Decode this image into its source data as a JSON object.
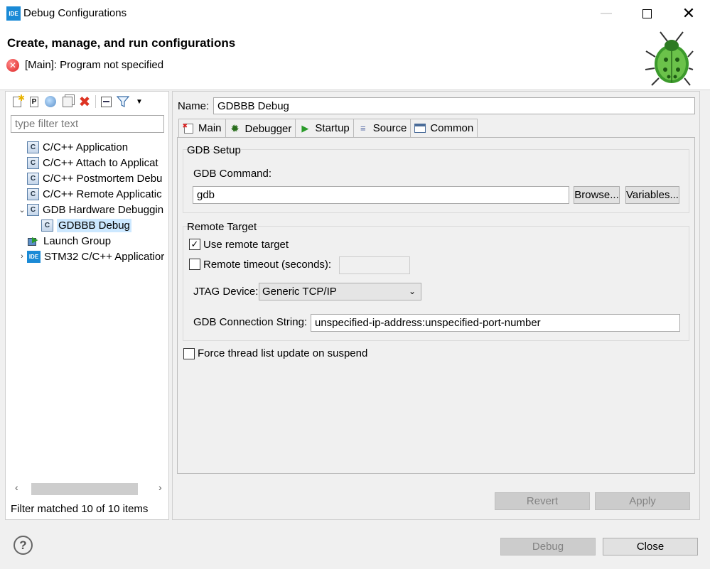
{
  "window": {
    "app_icon": "IDE",
    "title": "Debug Configurations",
    "minimize_icon": "minimize-icon",
    "maximize_icon": "maximize-icon",
    "close_icon": "close-icon"
  },
  "header": {
    "title": "Create, manage, and run configurations",
    "error_message": "[Main]: Program not specified"
  },
  "left_panel": {
    "toolbar_icons": [
      "new-configuration-icon",
      "new-prototype-icon",
      "export-icon",
      "duplicate-icon",
      "delete-icon",
      "collapse-all-icon",
      "filter-icon",
      "view-menu-icon"
    ],
    "filter_placeholder": "type filter text",
    "tree": [
      {
        "label": "C/C++ Application"
      },
      {
        "label": "C/C++ Attach to Applicat"
      },
      {
        "label": "C/C++ Postmortem Debu"
      },
      {
        "label": "C/C++ Remote Applicatic"
      },
      {
        "label": "GDB Hardware Debuggin"
      },
      {
        "label": "GDBBB Debug"
      },
      {
        "label": "Launch Group"
      },
      {
        "label": "STM32 C/C++ Applicatior"
      }
    ],
    "filter_status": "Filter matched 10 of 10 items"
  },
  "right_panel": {
    "name_label": "Name:",
    "name_value": "GDBBB Debug",
    "tabs": [
      {
        "label": "Main"
      },
      {
        "label": "Debugger"
      },
      {
        "label": "Startup"
      },
      {
        "label": "Source"
      },
      {
        "label": "Common"
      }
    ],
    "gdb_setup": {
      "title": "GDB Setup",
      "command_label": "GDB Command:",
      "command_value": "gdb",
      "browse_label": "Browse...",
      "variables_label": "Variables..."
    },
    "remote_target": {
      "title": "Remote Target",
      "use_remote_label": "Use remote target",
      "use_remote_checked": true,
      "timeout_label": "Remote timeout (seconds):",
      "timeout_checked": false,
      "timeout_value": "",
      "jtag_label": "JTAG Device:",
      "jtag_value": "Generic TCP/IP",
      "connection_label": "GDB Connection String:",
      "connection_value": "unspecified-ip-address:unspecified-port-number"
    },
    "force_thread_label": "Force thread list update on suspend",
    "force_thread_checked": false,
    "revert_label": "Revert",
    "apply_label": "Apply"
  },
  "footer": {
    "debug_label": "Debug",
    "close_label": "Close"
  }
}
